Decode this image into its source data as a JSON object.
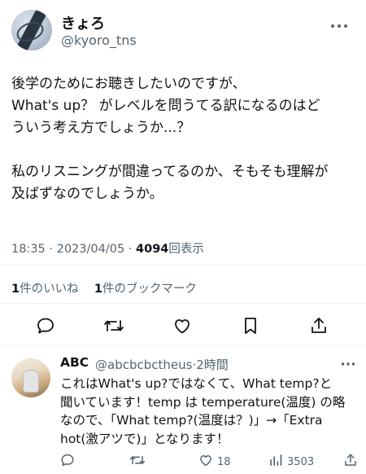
{
  "author": {
    "display_name": "きょろ",
    "handle": "@kyoro_tns",
    "more_icon": "ellipsis-icon"
  },
  "tweet": {
    "text": "後学のためにお聴きしたいのですが、\nWhat's up？ がレベルを問うてる訳になるのはど\nういう考え方でしょうか...？\n\n私のリスニングが間違ってるのか、そもそも理解が\n及ばずなのでしょうか。",
    "time": "18:35",
    "date": "2023/04/05",
    "views_count": "4094",
    "views_label": "回表示"
  },
  "stats": {
    "likes_count": "1",
    "likes_label": "件のいいね",
    "bookmarks_count": "1",
    "bookmarks_label": "件のブックマーク"
  },
  "actions": [
    "reply-icon",
    "retweet-icon",
    "like-icon",
    "bookmark-icon",
    "share-icon"
  ],
  "reply": {
    "display_name": "ABC",
    "handle": "@abcbcbctheus",
    "time": "2時間",
    "text": "これはWhat's up?ではなくて、What temp?と\n聞いています！temp は temperature(温度) の略\nなので、「What temp?(温度は？)」→「Extra\nhot(激アツで)」となります！",
    "like_count": "18",
    "view_count": "3503"
  },
  "colors": {
    "text_primary": "#0f1419",
    "text_secondary": "#536471",
    "divider": "#eff3f4"
  }
}
